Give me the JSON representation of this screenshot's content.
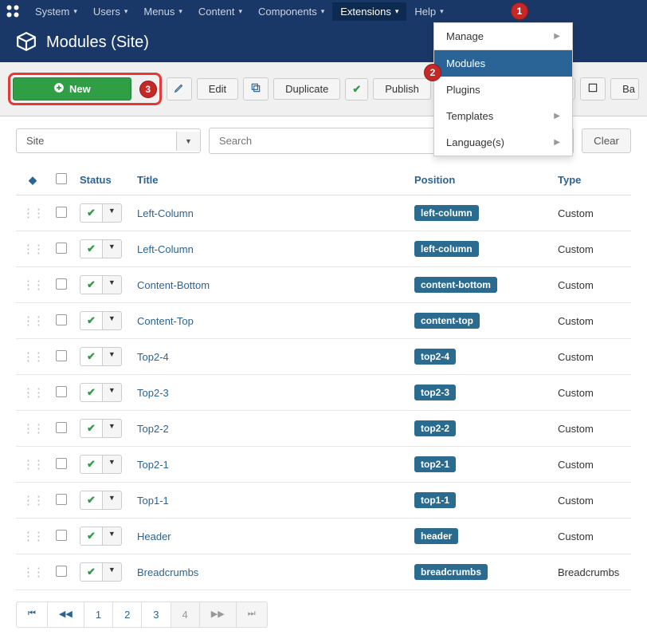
{
  "topnav": {
    "items": [
      {
        "label": "System"
      },
      {
        "label": "Users"
      },
      {
        "label": "Menus"
      },
      {
        "label": "Content"
      },
      {
        "label": "Components"
      },
      {
        "label": "Extensions"
      },
      {
        "label": "Help"
      }
    ]
  },
  "dropdown": {
    "items": [
      {
        "label": "Manage",
        "has_sub": true
      },
      {
        "label": "Modules",
        "selected": true
      },
      {
        "label": "Plugins"
      },
      {
        "label": "Templates",
        "has_sub": true
      },
      {
        "label": "Language(s)",
        "has_sub": true
      }
    ]
  },
  "page": {
    "title": "Modules (Site)"
  },
  "toolbar": {
    "new": "New",
    "edit": "Edit",
    "duplicate": "Duplicate",
    "publish": "Publish",
    "batch_partial": "Ba"
  },
  "filters": {
    "site_select": "Site",
    "search_placeholder": "Search",
    "clear": "Clear"
  },
  "table": {
    "headers": {
      "status": "Status",
      "title": "Title",
      "position": "Position",
      "type": "Type"
    },
    "rows": [
      {
        "title": "Left-Column",
        "position": "left-column",
        "type": "Custom"
      },
      {
        "title": "Left-Column",
        "position": "left-column",
        "type": "Custom"
      },
      {
        "title": "Content-Bottom",
        "position": "content-bottom",
        "type": "Custom"
      },
      {
        "title": "Content-Top",
        "position": "content-top",
        "type": "Custom"
      },
      {
        "title": "Top2-4",
        "position": "top2-4",
        "type": "Custom"
      },
      {
        "title": "Top2-3",
        "position": "top2-3",
        "type": "Custom"
      },
      {
        "title": "Top2-2",
        "position": "top2-2",
        "type": "Custom"
      },
      {
        "title": "Top2-1",
        "position": "top2-1",
        "type": "Custom"
      },
      {
        "title": "Top1-1",
        "position": "top1-1",
        "type": "Custom"
      },
      {
        "title": "Header",
        "position": "header",
        "type": "Custom"
      },
      {
        "title": "Breadcrumbs",
        "position": "breadcrumbs",
        "type": "Breadcrumbs"
      }
    ]
  },
  "pagination": {
    "pages": [
      "1",
      "2",
      "3",
      "4"
    ]
  },
  "markers": {
    "m1": "1",
    "m2": "2",
    "m3": "3"
  }
}
